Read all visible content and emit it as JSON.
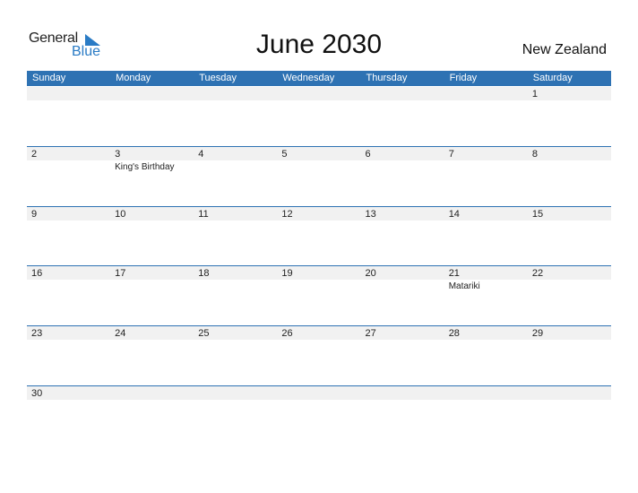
{
  "logo": {
    "general": "General",
    "blue": "Blue"
  },
  "title": "June 2030",
  "country": "New Zealand",
  "weekdays": [
    "Sunday",
    "Monday",
    "Tuesday",
    "Wednesday",
    "Thursday",
    "Friday",
    "Saturday"
  ],
  "weeks": [
    [
      {
        "day": ""
      },
      {
        "day": ""
      },
      {
        "day": ""
      },
      {
        "day": ""
      },
      {
        "day": ""
      },
      {
        "day": ""
      },
      {
        "day": "1"
      }
    ],
    [
      {
        "day": "2"
      },
      {
        "day": "3",
        "holiday": "King's Birthday"
      },
      {
        "day": "4"
      },
      {
        "day": "5"
      },
      {
        "day": "6"
      },
      {
        "day": "7"
      },
      {
        "day": "8"
      }
    ],
    [
      {
        "day": "9"
      },
      {
        "day": "10"
      },
      {
        "day": "11"
      },
      {
        "day": "12"
      },
      {
        "day": "13"
      },
      {
        "day": "14"
      },
      {
        "day": "15"
      }
    ],
    [
      {
        "day": "16"
      },
      {
        "day": "17"
      },
      {
        "day": "18"
      },
      {
        "day": "19"
      },
      {
        "day": "20"
      },
      {
        "day": "21",
        "holiday": "Matariki"
      },
      {
        "day": "22"
      }
    ],
    [
      {
        "day": "23"
      },
      {
        "day": "24"
      },
      {
        "day": "25"
      },
      {
        "day": "26"
      },
      {
        "day": "27"
      },
      {
        "day": "28"
      },
      {
        "day": "29"
      }
    ],
    [
      {
        "day": "30"
      },
      {
        "day": ""
      },
      {
        "day": ""
      },
      {
        "day": ""
      },
      {
        "day": ""
      },
      {
        "day": ""
      },
      {
        "day": ""
      }
    ]
  ],
  "colors": {
    "header": "#2e72b3",
    "brand_blue": "#2a7bc5",
    "band": "#f1f1f1"
  }
}
